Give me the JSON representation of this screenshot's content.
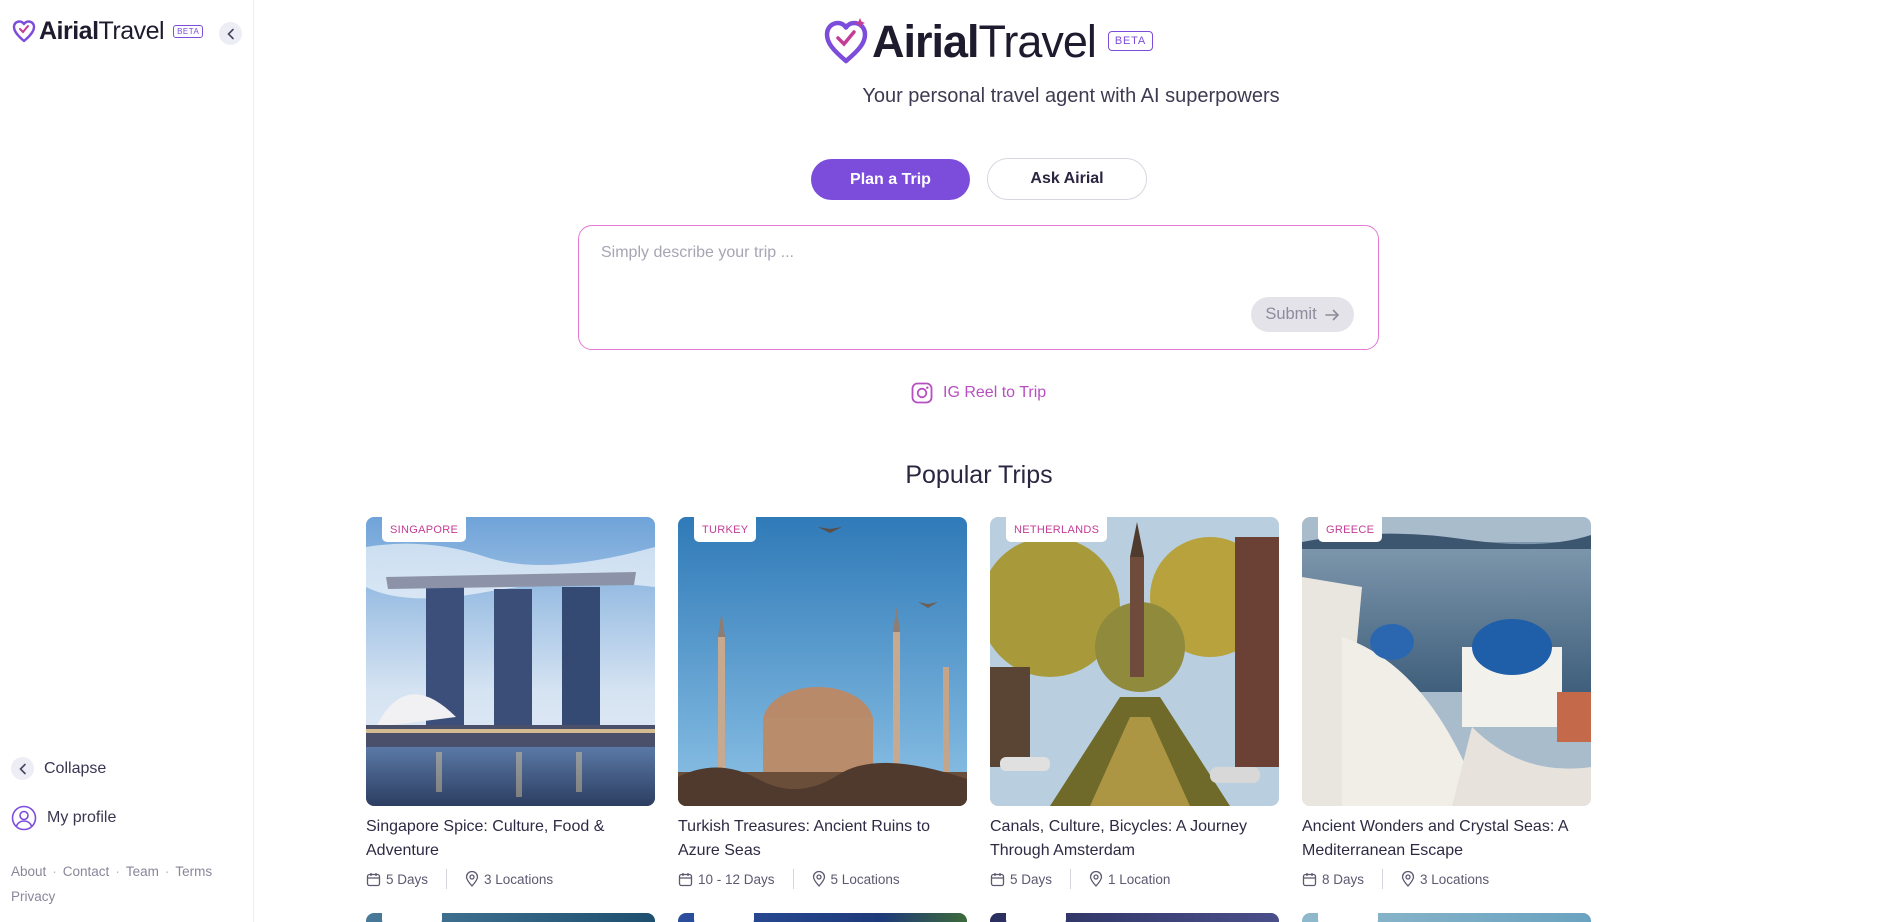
{
  "sidebar": {
    "logo": {
      "bold": "Airial",
      "light": "Travel",
      "badge": "BETA"
    },
    "collapse_label": "Collapse",
    "profile_label": "My profile",
    "links": [
      "About",
      "Contact",
      "Team",
      "Terms",
      "Privacy"
    ]
  },
  "header": {
    "logo": {
      "bold": "Airial",
      "light": "Travel",
      "badge": "BETA"
    },
    "tagline": "Your personal travel agent with AI superpowers"
  },
  "mode_tabs": {
    "plan_label": "Plan a Trip",
    "ask_label": "Ask Airial",
    "active": "plan"
  },
  "prompt": {
    "placeholder": "Simply describe your trip ...",
    "value": "",
    "submit_label": "Submit"
  },
  "ig_link": {
    "label": "IG Reel to Trip"
  },
  "popular": {
    "title": "Popular Trips",
    "cards": [
      {
        "tag": "SINGAPORE",
        "title": "Singapore Spice: Culture, Food & Adventure",
        "days": "5 Days",
        "locations": "3 Locations"
      },
      {
        "tag": "TURKEY",
        "title": "Turkish Treasures: Ancient Ruins to Azure Seas",
        "days": "10 - 12 Days",
        "locations": "5 Locations"
      },
      {
        "tag": "NETHERLANDS",
        "title": "Canals, Culture, Bicycles: A Journey Through Amsterdam",
        "days": "5 Days",
        "locations": "1 Location"
      },
      {
        "tag": "GREECE",
        "title": "Ancient Wonders and Crystal Seas: A Mediterranean Escape",
        "days": "8 Days",
        "locations": "3 Locations"
      }
    ]
  },
  "colors": {
    "accent": "#7c4ddb",
    "tag_text": "#c33c96",
    "prompt_border": "#e27ad3",
    "ig_link": "#b84fc1"
  }
}
